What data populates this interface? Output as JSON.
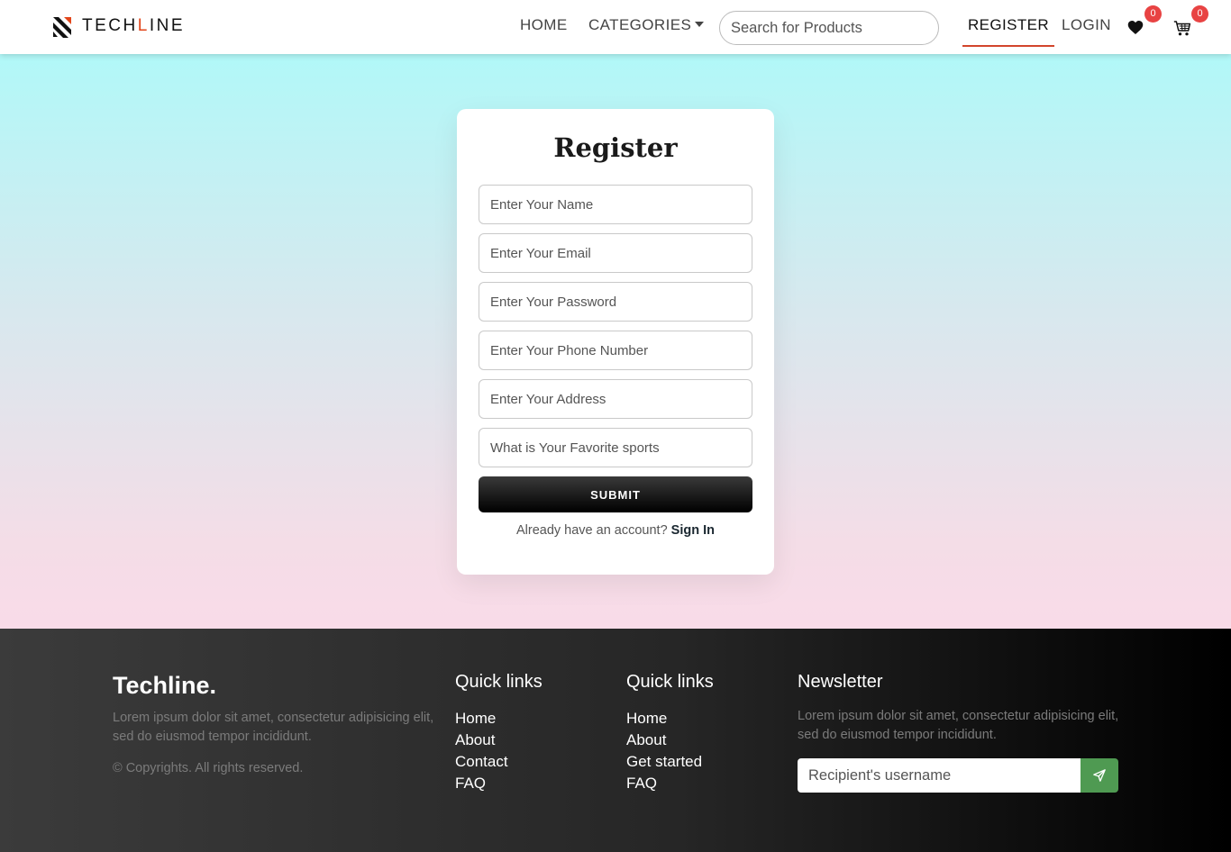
{
  "nav": {
    "brand_prefix": "TECH",
    "brand_accent": "L",
    "brand_suffix": "INE",
    "home": "HOME",
    "categories": "CATEGORIES",
    "search_placeholder": "Search for Products",
    "register": "REGISTER",
    "login": "LOGIN",
    "wishlist_count": "0",
    "cart_count": "0"
  },
  "form": {
    "title": "Register",
    "name_placeholder": "Enter Your Name",
    "email_placeholder": "Enter Your Email",
    "password_placeholder": "Enter Your Password",
    "phone_placeholder": "Enter Your Phone Number",
    "address_placeholder": "Enter Your Address",
    "sports_placeholder": "What is Your Favorite sports",
    "submit": "SUBMIT",
    "signin_prompt": "Already have an account?",
    "signin_link": "Sign In"
  },
  "footer": {
    "brand": "Techline.",
    "about": "Lorem ipsum dolor sit amet, consectetur adipisicing elit, sed do eiusmod tempor incididunt.",
    "copyright": "© Copyrights. All rights reserved.",
    "col1": {
      "heading": "Quick links",
      "links": [
        "Home",
        "About",
        "Contact",
        "FAQ"
      ]
    },
    "col2": {
      "heading": "Quick links",
      "links": [
        "Home",
        "About",
        "Get started",
        "FAQ"
      ]
    },
    "newsletter": {
      "heading": "Newsletter",
      "text": "Lorem ipsum dolor sit amet, consectetur adipisicing elit, sed do eiusmod tempor incididunt.",
      "placeholder": "Recipient's username"
    }
  },
  "colors": {
    "brand_accent": "#e2451a",
    "active_underline": "#d2452c",
    "badge": "#e84343",
    "send_button": "#4f9a52"
  },
  "icons": {
    "logo": "techline-logo-icon",
    "wishlist": "heart-icon",
    "cart": "cart-icon",
    "send": "send-icon",
    "dropdown": "caret-down-icon"
  }
}
